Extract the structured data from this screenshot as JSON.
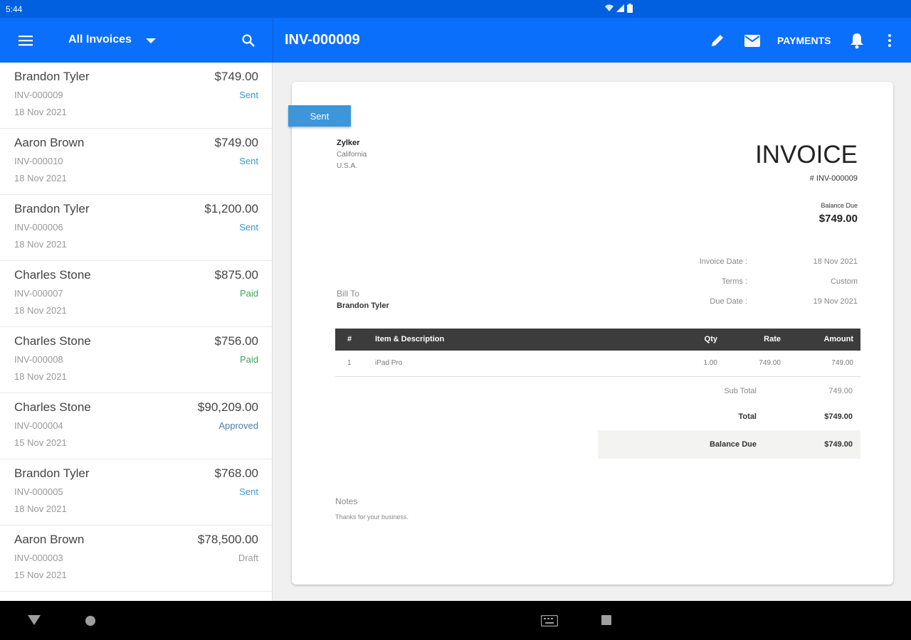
{
  "status_bar": {
    "time": "5:44"
  },
  "app_bar": {
    "filter_label": "All Invoices",
    "doc_title": "INV-000009",
    "payments_label": "PAYMENTS"
  },
  "invoice_list": [
    {
      "name": "Brandon Tyler",
      "amount": "$749.00",
      "number": "INV-000009",
      "status": "Sent",
      "date": "18 Nov 2021"
    },
    {
      "name": "Aaron Brown",
      "amount": "$749.00",
      "number": "INV-000010",
      "status": "Sent",
      "date": "18 Nov 2021"
    },
    {
      "name": "Brandon Tyler",
      "amount": "$1,200.00",
      "number": "INV-000006",
      "status": "Sent",
      "date": "18 Nov 2021"
    },
    {
      "name": "Charles Stone",
      "amount": "$875.00",
      "number": "INV-000007",
      "status": "Paid",
      "date": "18 Nov 2021"
    },
    {
      "name": "Charles Stone",
      "amount": "$756.00",
      "number": "INV-000008",
      "status": "Paid",
      "date": "18 Nov 2021"
    },
    {
      "name": "Charles Stone",
      "amount": "$90,209.00",
      "number": "INV-000004",
      "status": "Approved",
      "date": "15 Nov 2021"
    },
    {
      "name": "Brandon Tyler",
      "amount": "$768.00",
      "number": "INV-000005",
      "status": "Sent",
      "date": "18 Nov 2021"
    },
    {
      "name": "Aaron Brown",
      "amount": "$78,500.00",
      "number": "INV-000003",
      "status": "Draft",
      "date": "15 Nov 2021"
    }
  ],
  "status_colors": {
    "Sent": "#3c96d9",
    "Paid": "#3aa856",
    "Approved": "#4a7fa8",
    "Draft": "#999999"
  },
  "invoice": {
    "ribbon": "Sent",
    "org_name": "Zylker",
    "org_state": "California",
    "org_country": "U.S.A.",
    "heading": "INVOICE",
    "number": "# INV-000009",
    "balance_due_label": "Balance Due",
    "balance_due_value": "$749.00",
    "invoice_date_label": "Invoice Date :",
    "invoice_date_value": "18 Nov 2021",
    "terms_label": "Terms :",
    "terms_value": "Custom",
    "due_date_label": "Due Date :",
    "due_date_value": "19 Nov 2021",
    "bill_to_label": "Bill To",
    "bill_to_name": "Brandon Tyler",
    "table_headers": {
      "index": "#",
      "item": "Item & Description",
      "qty": "Qty",
      "rate": "Rate",
      "amount": "Amount"
    },
    "items": [
      {
        "index": "1",
        "item": "iPad Pro",
        "qty": "1.00",
        "rate": "749.00",
        "amount": "749.00"
      }
    ],
    "sub_total_label": "Sub Total",
    "sub_total_value": "749.00",
    "total_label": "Total",
    "total_value": "$749.00",
    "balance_label": "Balance Due",
    "balance_value": "$749.00",
    "notes_label": "Notes",
    "notes_text": "Thanks for your business."
  }
}
